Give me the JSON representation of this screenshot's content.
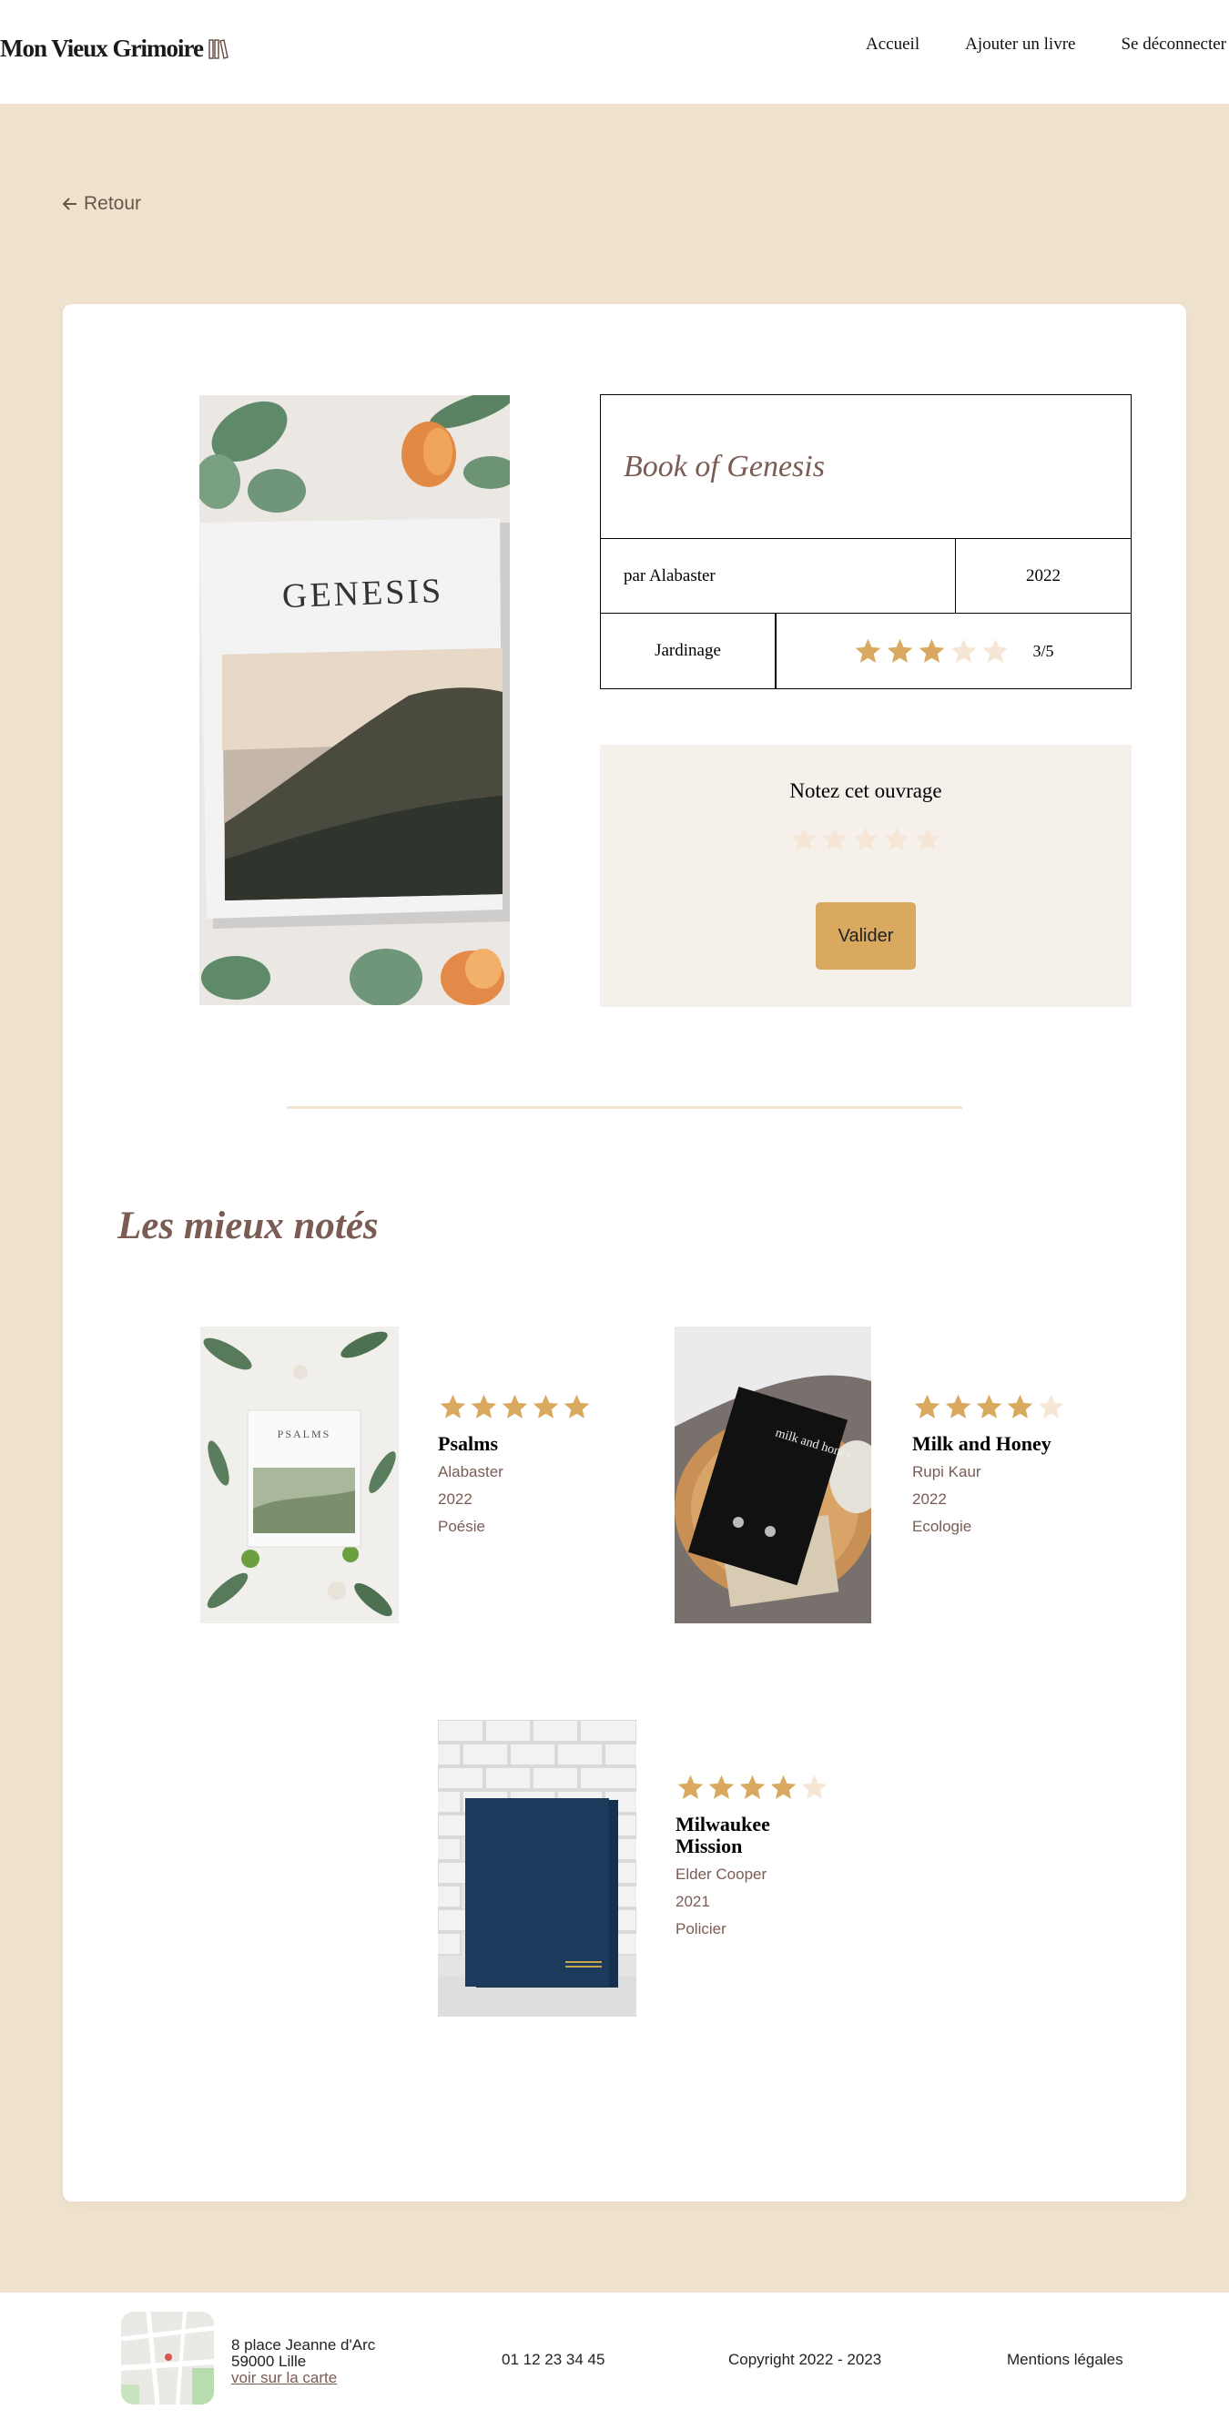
{
  "header": {
    "logo": "Mon Vieux Grimoire",
    "nav": [
      "Accueil",
      "Ajouter un livre",
      "Se déconnecter"
    ]
  },
  "back_label": "Retour",
  "book": {
    "title": "Book of Genesis",
    "author": "par Alabaster",
    "year": "2022",
    "genre": "Jardinage",
    "rating": 3,
    "rating_text": "3/5",
    "cover_text": "GENESIS"
  },
  "rate": {
    "label": "Notez cet ouvrage",
    "selected": 0,
    "submit_label": "Valider"
  },
  "best_rated": {
    "title": "Les mieux notés",
    "books": [
      {
        "title": "Psalms",
        "author": "Alabaster",
        "year": "2022",
        "genre": "Poésie",
        "rating": 5,
        "cover_text": "PSALMS"
      },
      {
        "title": "Milk and Honey",
        "author": "Rupi Kaur",
        "year": "2022",
        "genre": "Ecologie",
        "rating": 4,
        "cover_text": "milk and honey"
      },
      {
        "title": "Milwaukee Mission",
        "author": "Elder Cooper",
        "year": "2021",
        "genre": "Policier",
        "rating": 4,
        "cover_text": ""
      }
    ]
  },
  "footer": {
    "address_line1": "8 place Jeanne d'Arc",
    "address_line2": "59000 Lille",
    "map_link": "voir sur la carte",
    "phone": "01 12 23 34 45",
    "copyright": "Copyright 2022 - 2023",
    "legal": "Mentions légales"
  },
  "colors": {
    "background": "#f0e3cd",
    "accent": "#d9a960",
    "star_empty": "#f5e6d6",
    "title": "#7a5c55"
  }
}
